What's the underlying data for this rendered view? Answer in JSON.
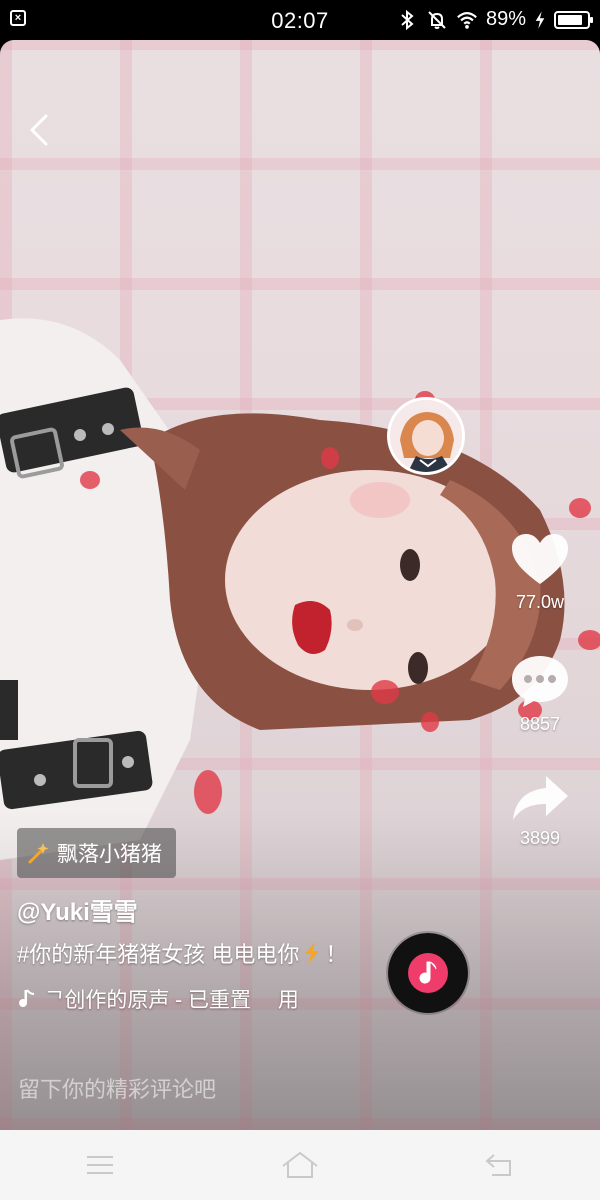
{
  "status_bar": {
    "time": "02:07",
    "battery_text": "89%",
    "battery_level": 0.89,
    "icons": [
      "notification-x-icon",
      "bluetooth-icon",
      "mute-bell-icon",
      "wifi-icon",
      "charging-bolt-icon",
      "battery-icon"
    ]
  },
  "video": {
    "back_icon": "chevron-left-icon"
  },
  "actions": {
    "avatar_icon": "creator-avatar",
    "like_icon": "heart-icon",
    "like_count": "77.0w",
    "comment_icon": "comment-bubble-icon",
    "comment_count": "8857",
    "share_icon": "share-arrow-icon",
    "share_count": "3899",
    "music_disc_icon": "music-disc-icon"
  },
  "caption": {
    "sticker_label": "飘落小猪猪",
    "username": "@Yuki雪雪",
    "description_text": "#你的新年猪猪女孩 电电电你",
    "description_end": "！",
    "music_text": "ᄀ创作的原声 - 已重置  用"
  },
  "comment": {
    "placeholder": "留下你的精彩评论吧"
  },
  "nav": {
    "icons": [
      "menu-icon",
      "home-icon",
      "back-icon"
    ]
  },
  "colors": {
    "accent": "#f03c6a",
    "bolt": "#f6a623"
  }
}
